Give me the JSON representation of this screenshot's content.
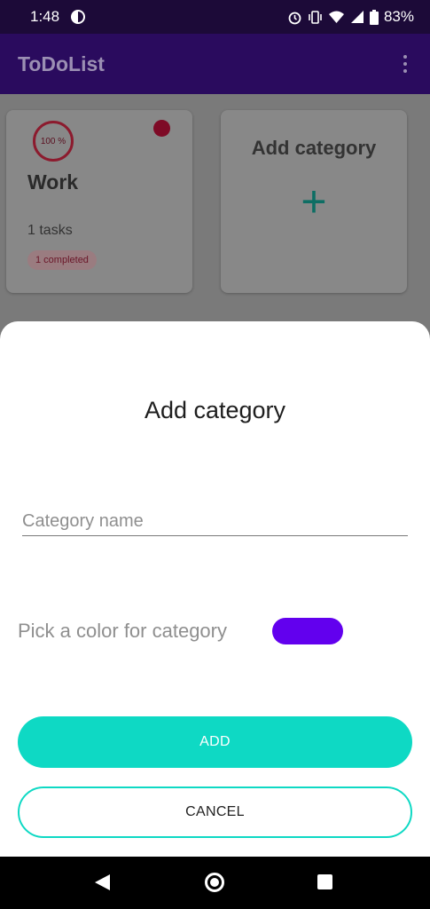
{
  "status_bar": {
    "time": "1:48",
    "battery": "83%",
    "icons": [
      "alarm-icon",
      "vibrate-icon",
      "wifi-icon",
      "signal-icon",
      "battery-icon"
    ]
  },
  "app_bar": {
    "title": "ToDoList"
  },
  "categories": [
    {
      "name": "Work",
      "progress": "100 %",
      "tasks": "1 tasks",
      "completed": "1 completed",
      "color": "#c2185b"
    }
  ],
  "add_card": {
    "title": "Add category",
    "plus": "+"
  },
  "dialog": {
    "title": "Add category",
    "name_placeholder": "Category name",
    "color_label": "Pick a color for category",
    "selected_color": "#6200ee",
    "add_label": "ADD",
    "cancel_label": "CANCEL"
  },
  "colors": {
    "accent": "#0ed9c4",
    "primary": "#2a0b5e"
  }
}
